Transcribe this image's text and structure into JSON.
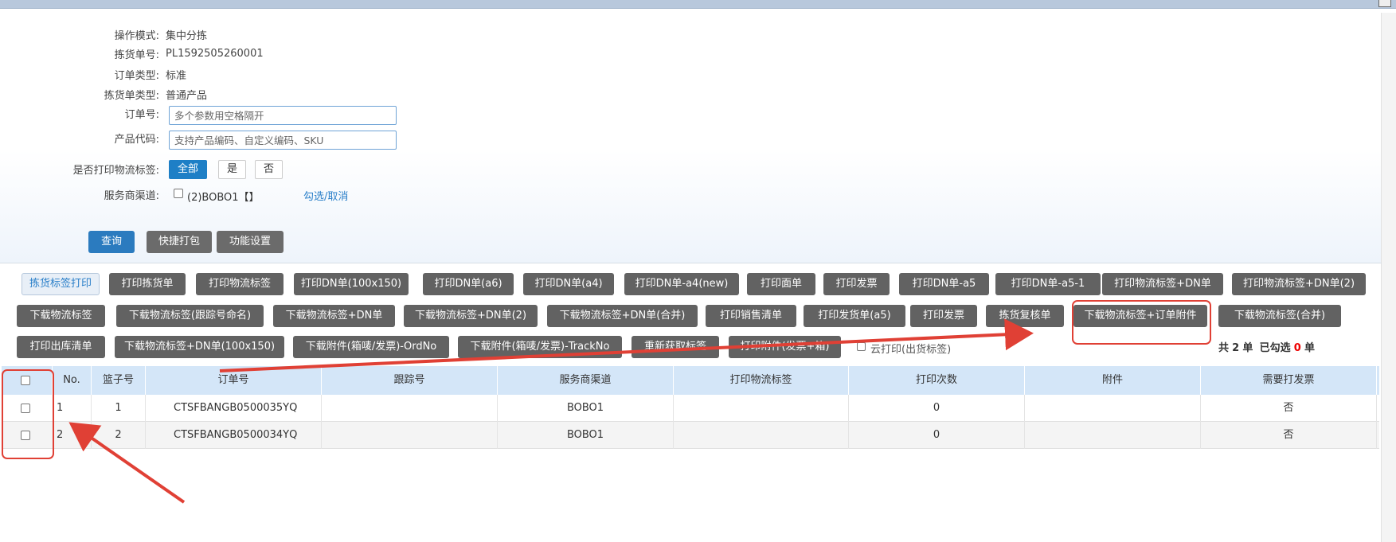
{
  "form": {
    "operation_mode": {
      "label": "操作模式:",
      "value": "集中分拣"
    },
    "pick_no": {
      "label": "拣货单号:",
      "value": "PL1592505260001"
    },
    "order_type": {
      "label": "订单类型:",
      "value": "标准"
    },
    "pick_type": {
      "label": "拣货单类型:",
      "value": "普通产品"
    },
    "order_no": {
      "label": "订单号:",
      "placeholder": "多个参数用空格隔开"
    },
    "product_code": {
      "label": "产品代码:",
      "placeholder": "支持产品编码、自定义编码、SKU"
    },
    "print_label": {
      "label": "是否打印物流标签:",
      "options": [
        "全部",
        "是",
        "否"
      ],
      "selected": "全部"
    },
    "channel": {
      "label": "服务商渠道:",
      "option": "(2)BOBO1【】",
      "toggle_link": "勾选/取消"
    }
  },
  "actions": {
    "query": "查询",
    "quick_pack": "快捷打包",
    "settings": "功能设置"
  },
  "toolbar_row1": [
    "拣货标签打印",
    "打印拣货单",
    "打印物流标签",
    "打印DN单(100x150)",
    "打印DN单(a6)",
    "打印DN单(a4)",
    "打印DN单-a4(new)",
    "打印面单",
    "打印发票",
    "打印DN单-a5",
    "打印DN单-a5-1",
    "打印物流标签+DN单",
    "打印物流标签+DN单(2)"
  ],
  "toolbar_row2": [
    "下载物流标签",
    "下载物流标签(跟踪号命名)",
    "下载物流标签+DN单",
    "下载物流标签+DN单(2)",
    "下载物流标签+DN单(合并)",
    "打印销售清单",
    "打印发货单(a5)",
    "打印发票",
    "拣货复核单",
    "下载物流标签+订单附件",
    "下载物流标签(合并)"
  ],
  "toolbar_row3": [
    "打印出库清单",
    "下载物流标签+DN单(100x150)",
    "下载附件(箱唛/发票)-OrdNo",
    "下载附件(箱唛/发票)-TrackNo",
    "重新获取标签",
    "打印附件(发票+箱)"
  ],
  "cloud_print": "云打印(出货标签)",
  "summary": {
    "prefix": "共",
    "total": "2",
    "unit1": "单",
    "selected_prefix": "已勾选",
    "selected": "0",
    "unit2": "单"
  },
  "table": {
    "headers": [
      "No.",
      "篮子号",
      "订单号",
      "跟踪号",
      "服务商渠道",
      "打印物流标签",
      "打印次数",
      "附件",
      "需要打发票"
    ],
    "rows": [
      [
        "1",
        "1",
        "CTSFBANGB0500035YQ",
        "",
        "BOBO1",
        "",
        "0",
        "",
        "否"
      ],
      [
        "2",
        "2",
        "CTSFBANGB0500034YQ",
        "",
        "BOBO1",
        "",
        "0",
        "",
        "否"
      ]
    ]
  },
  "colors": {
    "accent": "#1e7fc6",
    "button_dark": "#626262",
    "header_bg": "#d4e6f8",
    "annotation_red": "#e04035"
  }
}
